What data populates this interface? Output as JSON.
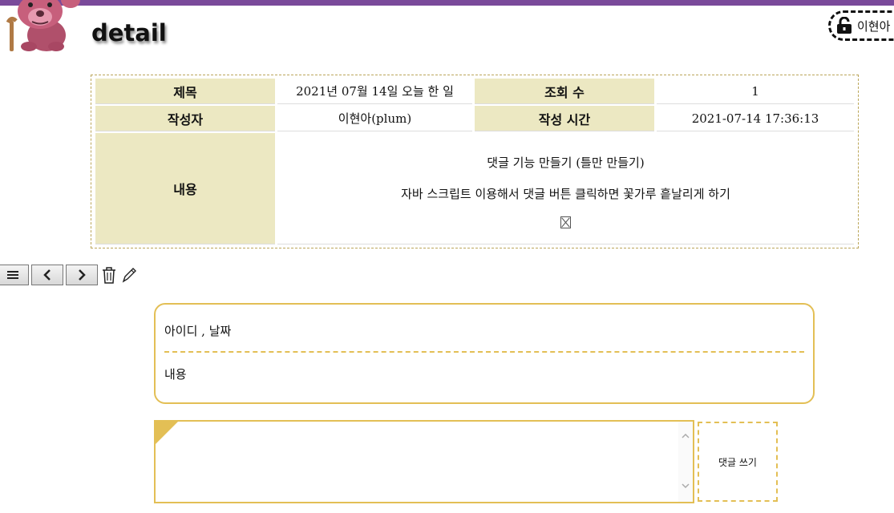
{
  "header": {
    "page_title": "detail",
    "user_badge": "이현아",
    "user_icon": "unlocked-lock-icon",
    "mascot_icon": "pink-bear-mascot"
  },
  "post": {
    "labels": {
      "title": "제목",
      "views": "조회 수",
      "author": "작성자",
      "created": "작성 시간",
      "content": "내용"
    },
    "title": "2021년 07월 14일 오늘 한 일",
    "views": "1",
    "author": "이현아(plum)",
    "created": "2021-07-14 17:36:13",
    "content_lines": [
      "댓글 기능 만들기 (틀만 만들기)",
      "자바 스크립트 이용해서 댓글 버튼 클릭하면 꽃가루 흩날리게 하기"
    ],
    "content_image": "broken-image-icon"
  },
  "toolbar": {
    "items": [
      "list-icon",
      "prev-icon",
      "next-icon",
      "trash-icon",
      "pencil-icon"
    ]
  },
  "comment": {
    "meta": "아이디 , 날짜",
    "body": "내용"
  },
  "comment_form": {
    "value": "",
    "submit_label": "댓글 쓰기"
  },
  "colors": {
    "top_bar": "#7a4a9a",
    "table_head_bg": "#ece8c2",
    "accent": "#e3bf55"
  }
}
